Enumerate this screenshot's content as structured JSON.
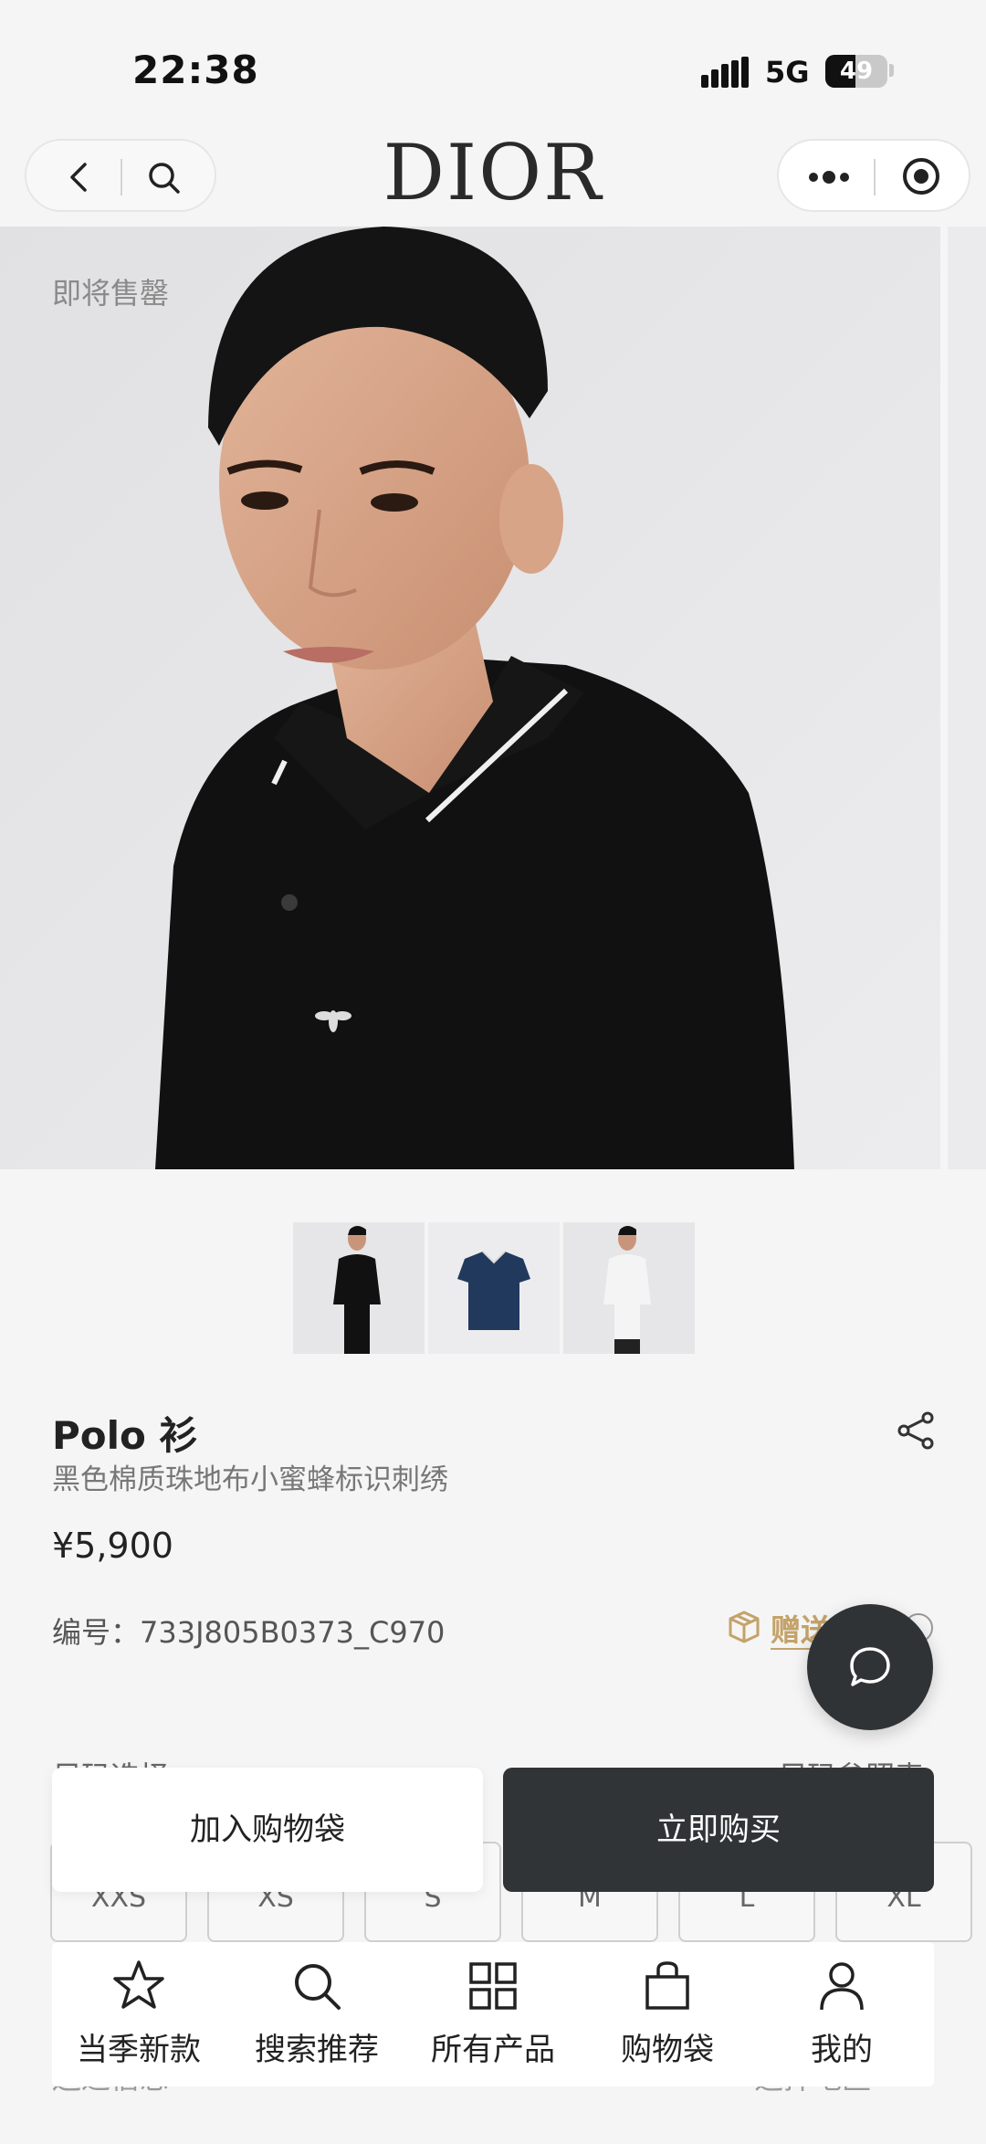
{
  "status_bar": {
    "time": "22:38",
    "network": "5G",
    "battery": "49",
    "battery_level_percent": 49
  },
  "nav": {
    "logo": "DIOR",
    "icons": [
      "back-arrow",
      "search",
      "more-dots",
      "close-circle"
    ]
  },
  "product": {
    "image_badge": "即将售罄",
    "thumbnails": [
      "black-polo-model",
      "navy-polo-flat",
      "white-polo-model"
    ],
    "name": "Polo 衫",
    "description": "黑色棉质珠地布小蜜蜂标识刺绣",
    "price": "¥5,900",
    "sku": "编号：733J805B0373_C970",
    "gift_label": "赠送",
    "colors": {
      "gift": "#c4a269",
      "dark": "#303437"
    }
  },
  "sizes": {
    "title": "尺码选择",
    "guide": "尺码参照表",
    "options": [
      "XXS",
      "XS",
      "S",
      "M",
      "L",
      "XL"
    ]
  },
  "actions": {
    "add_to_bag": "加入购物袋",
    "buy_now": "立即购买"
  },
  "delivery": {
    "label": "送达信息",
    "select_region": "选择地区"
  },
  "tabbar": {
    "items": [
      {
        "label": "当季新款",
        "icon": "star"
      },
      {
        "label": "搜索推荐",
        "icon": "search"
      },
      {
        "label": "所有产品",
        "icon": "grid"
      },
      {
        "label": "购物袋",
        "icon": "bag"
      },
      {
        "label": "我的",
        "icon": "person"
      }
    ]
  }
}
